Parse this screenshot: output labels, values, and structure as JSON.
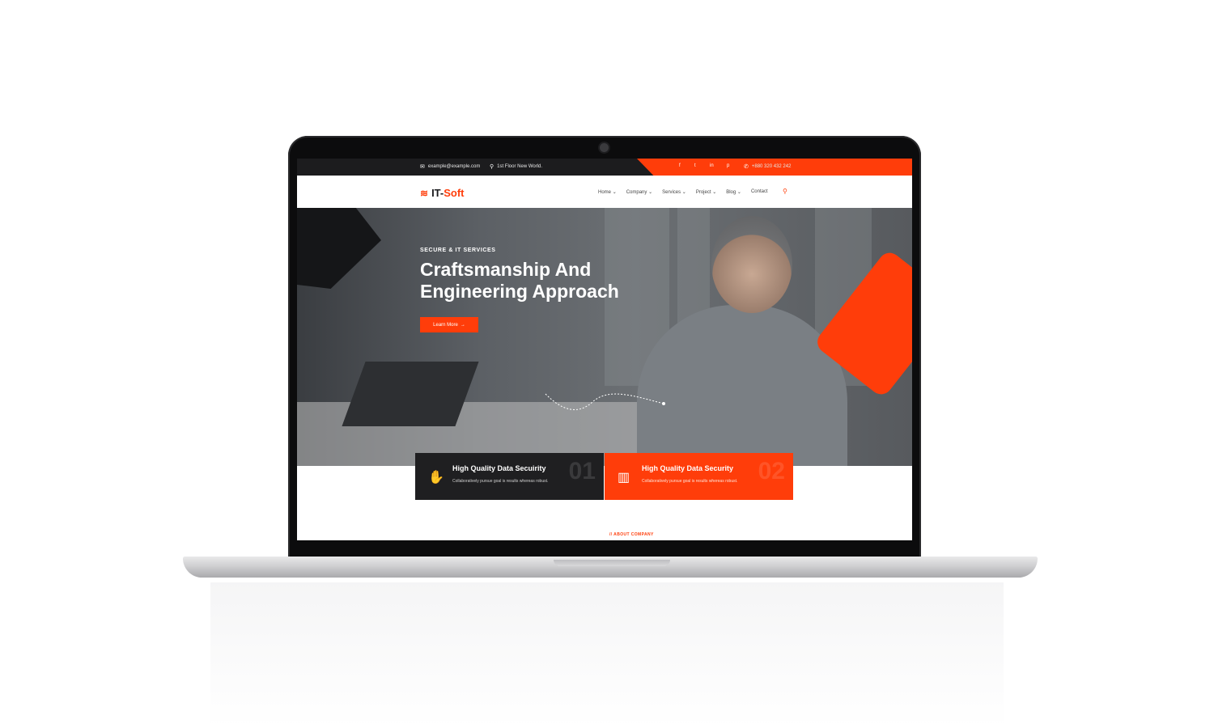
{
  "topbar": {
    "email": "example@example.com",
    "address": "1st Floor New World.",
    "phone": "+880 320 432 242",
    "social": [
      "f",
      "t",
      "in",
      "p"
    ]
  },
  "logo": {
    "part1": "IT-",
    "part2": "Soft"
  },
  "nav": {
    "items": [
      "Home",
      "Company",
      "Services",
      "Project",
      "Blog",
      "Contact"
    ]
  },
  "hero": {
    "tag": "SECURE & IT SERVICES",
    "title_line1": "Craftsmanship And",
    "title_line2": "Engineering Approach",
    "button_label": "Learn More"
  },
  "cards": [
    {
      "title": "High Quality Data Secuirity",
      "text": "Collaboratively pursue goal is results whereas robust.",
      "number": "01"
    },
    {
      "title": "High Quality Data Security",
      "text": "Collaboratively pursue goal is results whereas robust.",
      "number": "02"
    }
  ],
  "about": {
    "tag": "// ABOUT COMPANY"
  },
  "colors": {
    "accent": "#ff3d0a",
    "dark": "#1c1c1e"
  },
  "icons": [
    "envelope-icon",
    "map-pin-icon",
    "phone-icon",
    "search-icon",
    "chevron-down-icon",
    "arrow-right-icon"
  ]
}
